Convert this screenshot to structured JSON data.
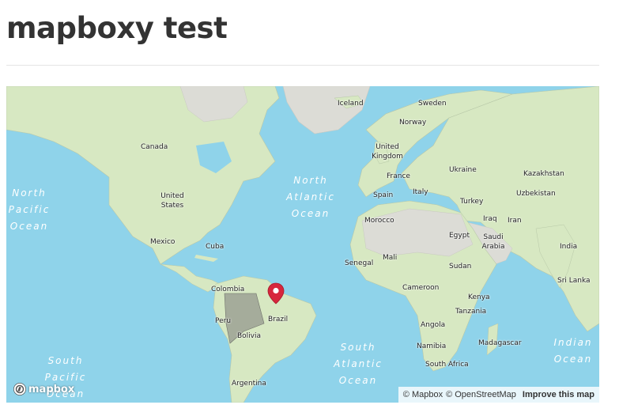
{
  "page": {
    "title": "mapboxy test"
  },
  "map": {
    "colors": {
      "water": "#8fd3ea",
      "land": "#d7e8c2",
      "land_gray": "#dcdcd6",
      "highlight": "#8a8c86",
      "marker": "#d7263d"
    },
    "countries": [
      {
        "id": "iceland",
        "label": "Iceland"
      },
      {
        "id": "sweden",
        "label": "Sweden"
      },
      {
        "id": "norway",
        "label": "Norway"
      },
      {
        "id": "canada",
        "label": "Canada"
      },
      {
        "id": "united-kingdom",
        "label": "United Kingdom"
      },
      {
        "id": "ukraine",
        "label": "Ukraine"
      },
      {
        "id": "kazakhstan",
        "label": "Kazakhstan"
      },
      {
        "id": "france",
        "label": "France"
      },
      {
        "id": "united-states",
        "label": "United States"
      },
      {
        "id": "spain",
        "label": "Spain"
      },
      {
        "id": "italy",
        "label": "Italy"
      },
      {
        "id": "uzbekistan",
        "label": "Uzbekistan"
      },
      {
        "id": "turkey",
        "label": "Turkey"
      },
      {
        "id": "morocco",
        "label": "Morocco"
      },
      {
        "id": "iraq",
        "label": "Iraq"
      },
      {
        "id": "iran",
        "label": "Iran"
      },
      {
        "id": "egypt",
        "label": "Egypt"
      },
      {
        "id": "saudi-arabia",
        "label": "Saudi Arabia"
      },
      {
        "id": "mexico",
        "label": "Mexico"
      },
      {
        "id": "cuba",
        "label": "Cuba"
      },
      {
        "id": "india",
        "label": "India"
      },
      {
        "id": "mali",
        "label": "Mali"
      },
      {
        "id": "senegal",
        "label": "Senegal"
      },
      {
        "id": "sudan",
        "label": "Sudan"
      },
      {
        "id": "sri-lanka",
        "label": "Sri Lanka"
      },
      {
        "id": "colombia",
        "label": "Colombia"
      },
      {
        "id": "cameroon",
        "label": "Cameroon"
      },
      {
        "id": "kenya",
        "label": "Kenya"
      },
      {
        "id": "peru",
        "label": "Peru"
      },
      {
        "id": "brazil",
        "label": "Brazil"
      },
      {
        "id": "tanzania",
        "label": "Tanzania"
      },
      {
        "id": "angola",
        "label": "Angola"
      },
      {
        "id": "bolivia",
        "label": "Bolivia"
      },
      {
        "id": "madagascar",
        "label": "Madagascar"
      },
      {
        "id": "namibia",
        "label": "Namibia"
      },
      {
        "id": "south-africa",
        "label": "South Africa"
      },
      {
        "id": "argentina",
        "label": "Argentina"
      }
    ],
    "oceans": [
      {
        "id": "north-pacific",
        "label": "North\nPacific\nOcean"
      },
      {
        "id": "north-atlantic",
        "label": "North\nAtlantic\nOcean"
      },
      {
        "id": "south-atlantic",
        "label": "South\nAtlantic\nOcean"
      },
      {
        "id": "south-pacific",
        "label": "South\nPacific\nOcean"
      },
      {
        "id": "indian",
        "label": "Indian\nOcean"
      }
    ],
    "logo_text": "mapbox",
    "attribution": {
      "mapbox": "© Mapbox",
      "osm": "© OpenStreetMap",
      "improve": "Improve this map"
    }
  }
}
